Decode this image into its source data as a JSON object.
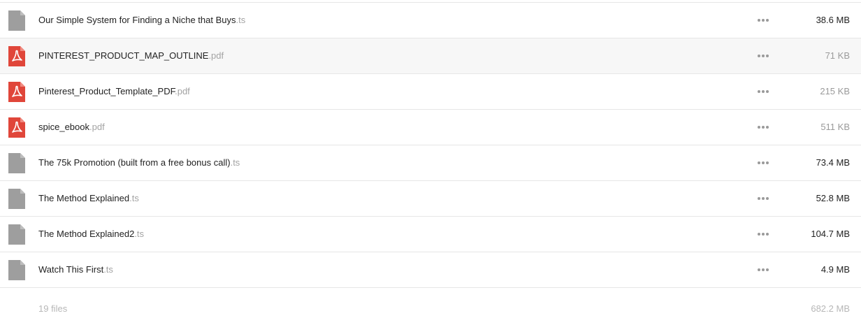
{
  "files": [
    {
      "name": "Our Simple System for Finding a Niche that Buys",
      "ext": ".ts",
      "type": "generic",
      "size": "38.6 MB",
      "size_muted": false
    },
    {
      "name": "PINTEREST_PRODUCT_MAP_OUTLINE",
      "ext": ".pdf",
      "type": "pdf",
      "size": "71 KB",
      "size_muted": true
    },
    {
      "name": "Pinterest_Product_Template_PDF",
      "ext": ".pdf",
      "type": "pdf",
      "size": "215 KB",
      "size_muted": true
    },
    {
      "name": "spice_ebook",
      "ext": ".pdf",
      "type": "pdf",
      "size": "511 KB",
      "size_muted": true
    },
    {
      "name": "The 75k Promotion (built from a free bonus call)",
      "ext": ".ts",
      "type": "generic",
      "size": "73.4 MB",
      "size_muted": false
    },
    {
      "name": "The Method Explained",
      "ext": ".ts",
      "type": "generic",
      "size": "52.8 MB",
      "size_muted": false
    },
    {
      "name": "The Method Explained2",
      "ext": ".ts",
      "type": "generic",
      "size": "104.7 MB",
      "size_muted": false
    },
    {
      "name": "Watch This First",
      "ext": ".ts",
      "type": "generic",
      "size": "4.9 MB",
      "size_muted": false
    }
  ],
  "footer": {
    "file_count": "19 files",
    "total_size": "682.2 MB"
  },
  "colors": {
    "pdf_icon": "#e0463a",
    "generic_icon": "#9e9e9e",
    "row_hover": "#f7f7f7"
  }
}
